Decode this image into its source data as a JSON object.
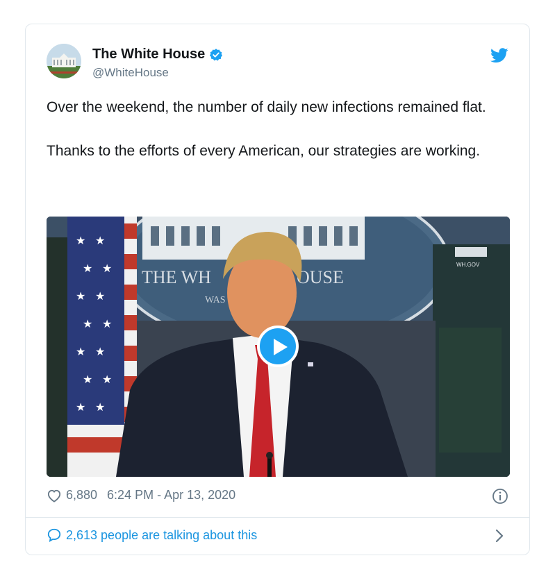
{
  "tweet": {
    "display_name": "The White House",
    "handle": "@WhiteHouse",
    "verified": true,
    "paragraphs": [
      "Over the weekend, the number of daily new infections remained flat.",
      "Thanks to the efforts of every American, our strategies are working."
    ],
    "video": {
      "seal_text_top": "THE WHITE HOUSE",
      "seal_text_bottom": "WASHINGTON",
      "watermark": "WH.GOV"
    },
    "likes": "6,880",
    "timestamp": "6:24 PM - Apr 13, 2020",
    "conversation": "2,613 people are talking about this"
  },
  "colors": {
    "accent": "#1da1f2",
    "link": "#1b95e0",
    "muted": "#657786",
    "text": "#14171a",
    "border": "#e1e8ed"
  },
  "icons": [
    "twitter-bird-icon",
    "verified-badge-icon",
    "heart-icon",
    "info-icon",
    "speech-bubble-icon",
    "chevron-right-icon",
    "play-icon"
  ]
}
